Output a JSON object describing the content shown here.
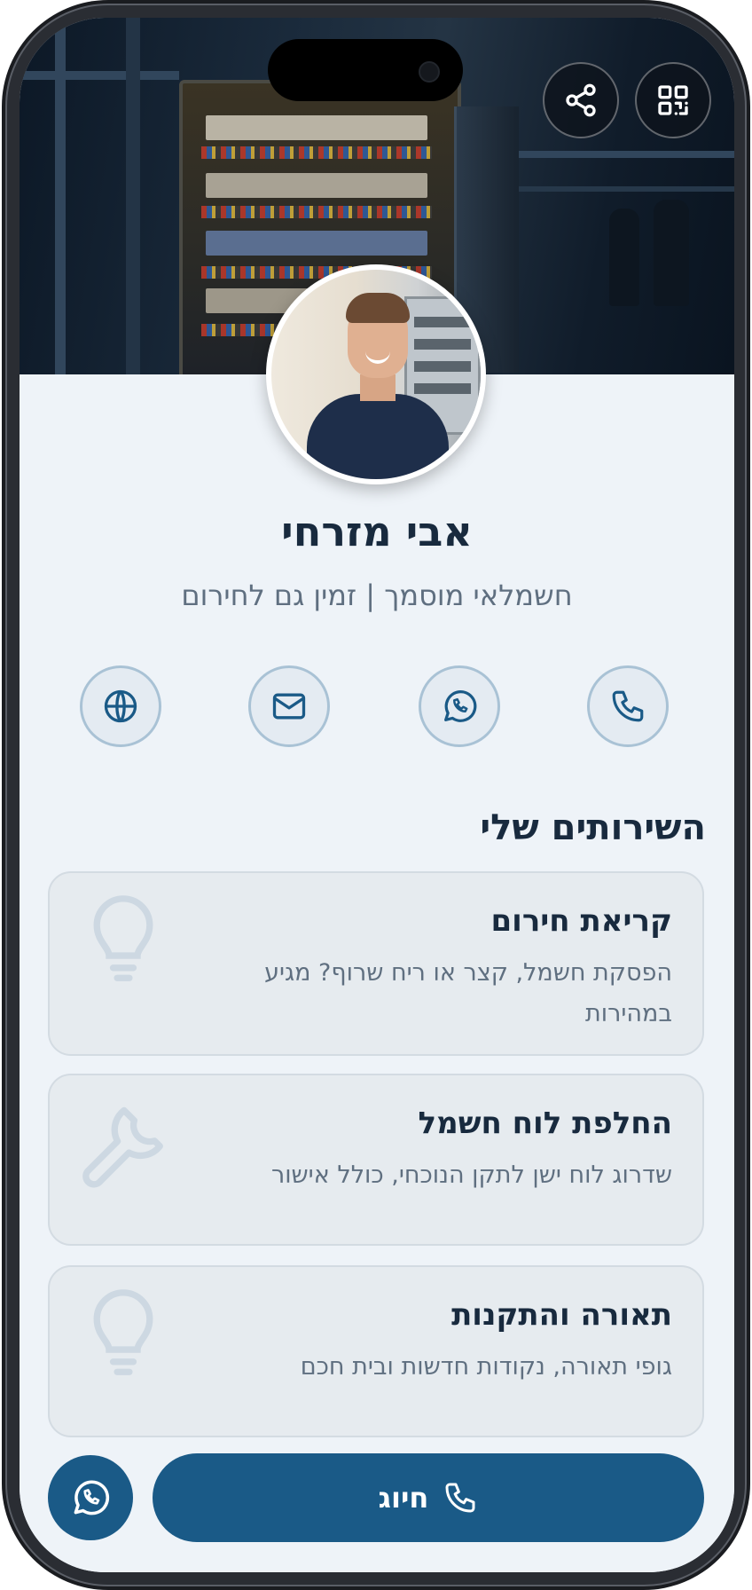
{
  "profile": {
    "name": "אבי מזרחי",
    "subtitle": "חשמלאי מוסמך | זמין גם לחירום"
  },
  "top_actions": {
    "share_icon": "share-icon",
    "qr_icon": "qr-code-icon"
  },
  "contact_actions": [
    {
      "icon": "phone-icon"
    },
    {
      "icon": "whatsapp-icon"
    },
    {
      "icon": "mail-icon"
    },
    {
      "icon": "globe-icon"
    }
  ],
  "services": {
    "title": "השירותים שלי",
    "items": [
      {
        "title": "קריאת חירום",
        "description": "הפסקת חשמל, קצר או ריח שרוף? מגיע במהירות",
        "icon": "lightbulb-icon"
      },
      {
        "title": "החלפת לוח חשמל",
        "description": "שדרוג לוח ישן לתקן הנוכחי, כולל אישור",
        "icon": "wrench-icon"
      },
      {
        "title": "תאורה והתקנות",
        "description": "גופי תאורה, נקודות חדשות ובית חכם",
        "icon": "lightbulb-icon"
      }
    ]
  },
  "bottom_bar": {
    "call_label": "חיוג",
    "whatsapp_icon": "whatsapp-icon"
  },
  "colors": {
    "primary": "#1a5a87",
    "text_dark": "#182a3e",
    "text_muted": "#5f6f80",
    "background": "#eef3f8",
    "card": "#e6ebef"
  }
}
